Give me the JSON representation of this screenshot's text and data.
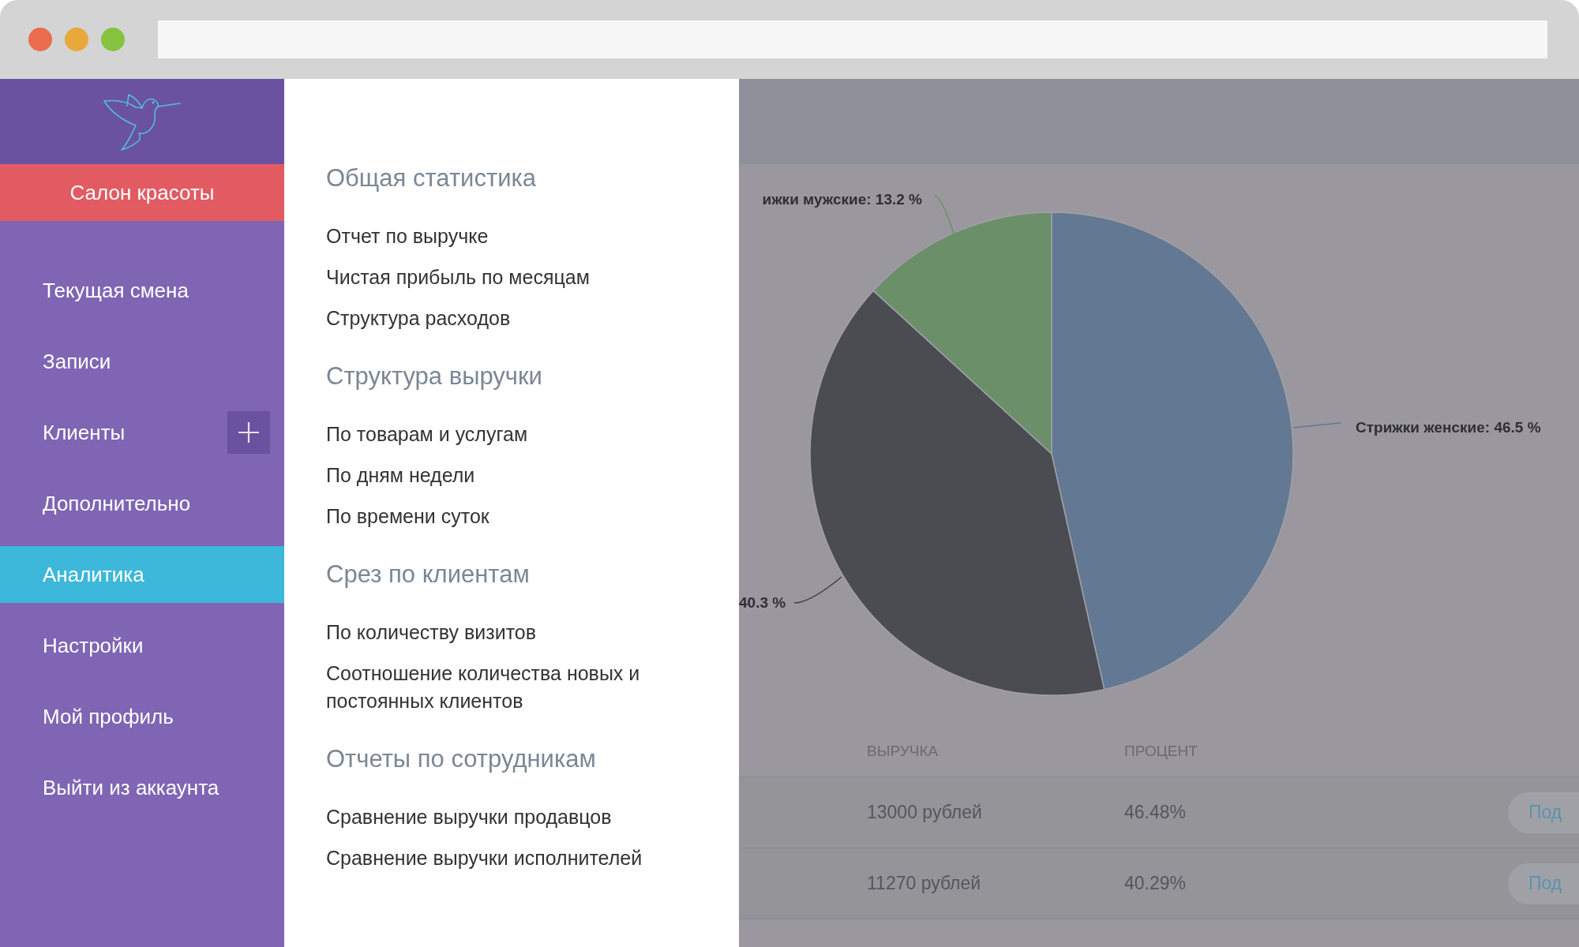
{
  "browser": {
    "window_buttons": [
      {
        "color": "#ec6c50"
      },
      {
        "color": "#e9a83a"
      },
      {
        "color": "#86c440"
      }
    ]
  },
  "sidebar": {
    "brand": "Салон красоты",
    "items": [
      {
        "label": "Текущая смена",
        "selected": false,
        "add_button": false
      },
      {
        "label": "Записи",
        "selected": false,
        "add_button": false
      },
      {
        "label": "Клиенты",
        "selected": false,
        "add_button": true
      },
      {
        "label": "Дополнительно",
        "selected": false,
        "add_button": false
      },
      {
        "label": "Аналитика",
        "selected": true,
        "add_button": false
      },
      {
        "label": "Настройки",
        "selected": false,
        "add_button": false
      },
      {
        "label": "Мой профиль",
        "selected": false,
        "add_button": false
      },
      {
        "label": "Выйти из аккаунта",
        "selected": false,
        "add_button": false
      }
    ]
  },
  "menu": {
    "sections": [
      {
        "title": "Общая статистика",
        "items": [
          "Отчет по выручке",
          "Чистая прибыль по месяцам",
          "Структура расходов"
        ]
      },
      {
        "title": "Структура выручки",
        "items": [
          "По товарам и услугам",
          "По дням недели",
          "По времени суток"
        ]
      },
      {
        "title": "Срез по клиентам",
        "items": [
          "По количеству визитов",
          "Соотношение количества новых и постоянных клиентов"
        ]
      },
      {
        "title": "Отчеты по сотрудникам",
        "items": [
          "Сравнение выручки продавцов",
          "Сравнение выручки исполнителей"
        ]
      }
    ]
  },
  "chart": {
    "chart_data": {
      "type": "pie",
      "categories": [
        "Стрижки женские: 46.5 %",
        "40.3 %",
        "ижки мужские: 13.2 %"
      ],
      "values": [
        46.5,
        40.3,
        13.2
      ]
    }
  },
  "table": {
    "columns": [
      "ВЫРУЧКА",
      "ПРОЦЕНТ"
    ],
    "rows": [
      {
        "cells": [
          "13000 рублей",
          "46.48%"
        ],
        "action": "Под"
      },
      {
        "cells": [
          "11270 рублей",
          "40.29%"
        ],
        "action": "Под"
      }
    ]
  }
}
